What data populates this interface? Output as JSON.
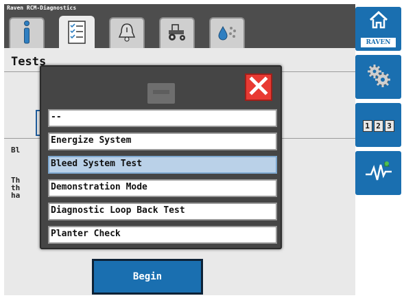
{
  "app": {
    "title": "Raven RCM-Diagnostics"
  },
  "tabs": [
    {
      "icon": "info-icon",
      "active": false
    },
    {
      "icon": "checklist-icon",
      "active": true
    },
    {
      "icon": "alarm-bell-icon",
      "active": false
    },
    {
      "icon": "tractor-icon",
      "active": false
    },
    {
      "icon": "drops-icon",
      "active": false
    }
  ],
  "page": {
    "title": "Tests",
    "side_text_1": "Bl",
    "side_text_2a": "Th",
    "side_text_2b": "th",
    "side_text_2c": "ha",
    "begin_label": "Begin"
  },
  "modal": {
    "options": [
      {
        "label": "--",
        "selected": false
      },
      {
        "label": "Energize System",
        "selected": false
      },
      {
        "label": "Bleed System Test",
        "selected": true
      },
      {
        "label": "Demonstration Mode",
        "selected": false
      },
      {
        "label": "Diagnostic Loop Back Test",
        "selected": false
      },
      {
        "label": "Planter Check",
        "selected": false
      }
    ]
  },
  "sidebar": {
    "home_brand": "RAVEN",
    "numpad_digits": [
      "1",
      "2",
      "3"
    ]
  },
  "colors": {
    "accent_blue": "#1a6fb0",
    "close_red": "#e83a33",
    "selected_row": "#bad1e8"
  }
}
